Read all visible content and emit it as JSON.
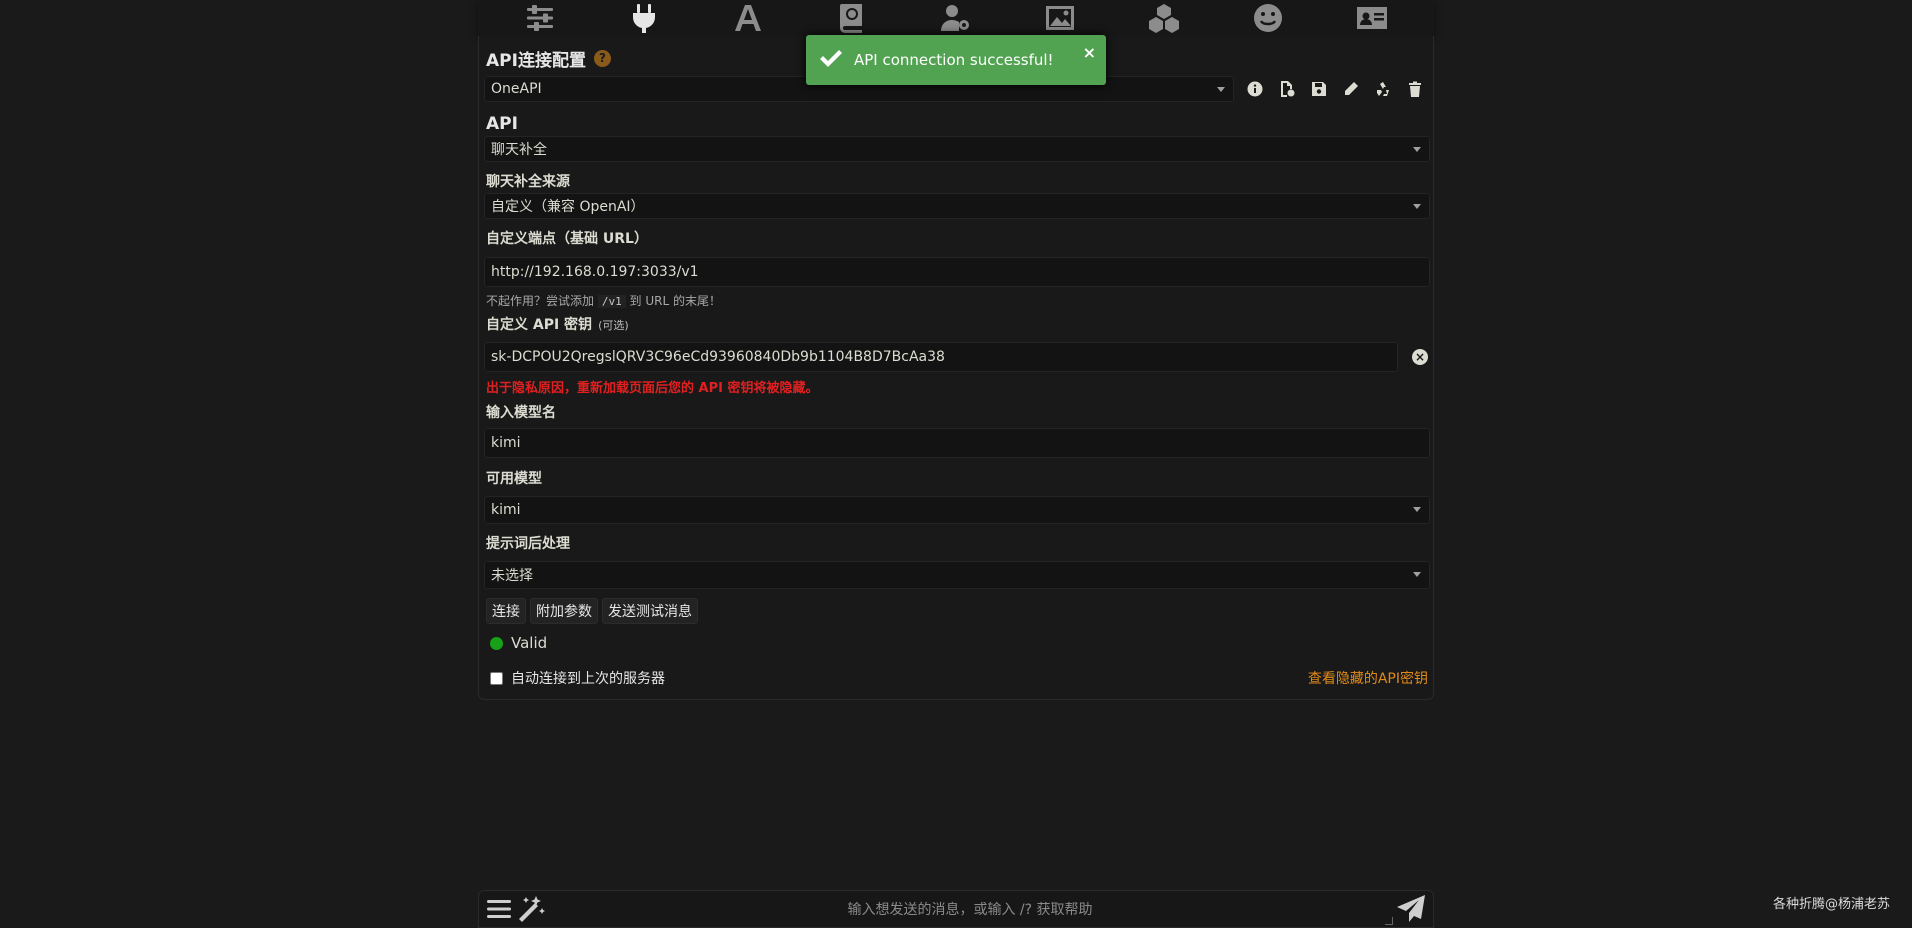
{
  "topbar": {
    "icons": [
      "sliders-icon",
      "plug-icon",
      "font-icon",
      "book-atlas-icon",
      "user-gear-icon",
      "image-icon",
      "cubes-icon",
      "smile-icon",
      "id-card-icon"
    ],
    "active": "plug-icon"
  },
  "panel": {
    "title": "API连接配置",
    "help": "?",
    "preset_value": "OneAPI",
    "api_heading": "API",
    "api_value": "聊天补全",
    "source_label": "聊天补全来源",
    "source_value": "自定义（兼容 OpenAI）",
    "endpoint_label": "自定义端点（基础 URL）",
    "endpoint_value": "http://192.168.0.197:3033/v1",
    "hint_pre": "不起作用？尝试添加",
    "hint_code": "/v1",
    "hint_post": "到 URL 的末尾！",
    "key_label": "自定义 API 密钥",
    "key_optional": "(可选)",
    "key_value": "sk-DCPOU2QregslQRV3C96eCd93960840Db9b1104B8D7BcAa38",
    "key_warning": "出于隐私原因，重新加载页面后您的 API 密钥将被隐藏。",
    "model_input_label": "输入模型名",
    "model_input_value": "kimi",
    "available_label": "可用模型",
    "available_value": "kimi",
    "postproc_label": "提示词后处理",
    "postproc_value": "未选择",
    "buttons": {
      "connect": "连接",
      "extra_params": "附加参数",
      "send_test": "发送测试消息"
    },
    "status": "Valid",
    "auto_connect_label": "自动连接到上次的服务器",
    "auto_connect_checked": false,
    "view_keys_link": "查看隐藏的API密钥"
  },
  "toast": {
    "message": "API connection successful!",
    "close": "×",
    "color": "#51a351"
  },
  "sendbar": {
    "placeholder": "输入想发送的消息，或输入 /? 获取帮助"
  },
  "watermark": "各种折腾@杨浦老苏",
  "colors": {
    "accent": "#e08a1a",
    "warning": "#e02020",
    "valid": "#18a018"
  }
}
